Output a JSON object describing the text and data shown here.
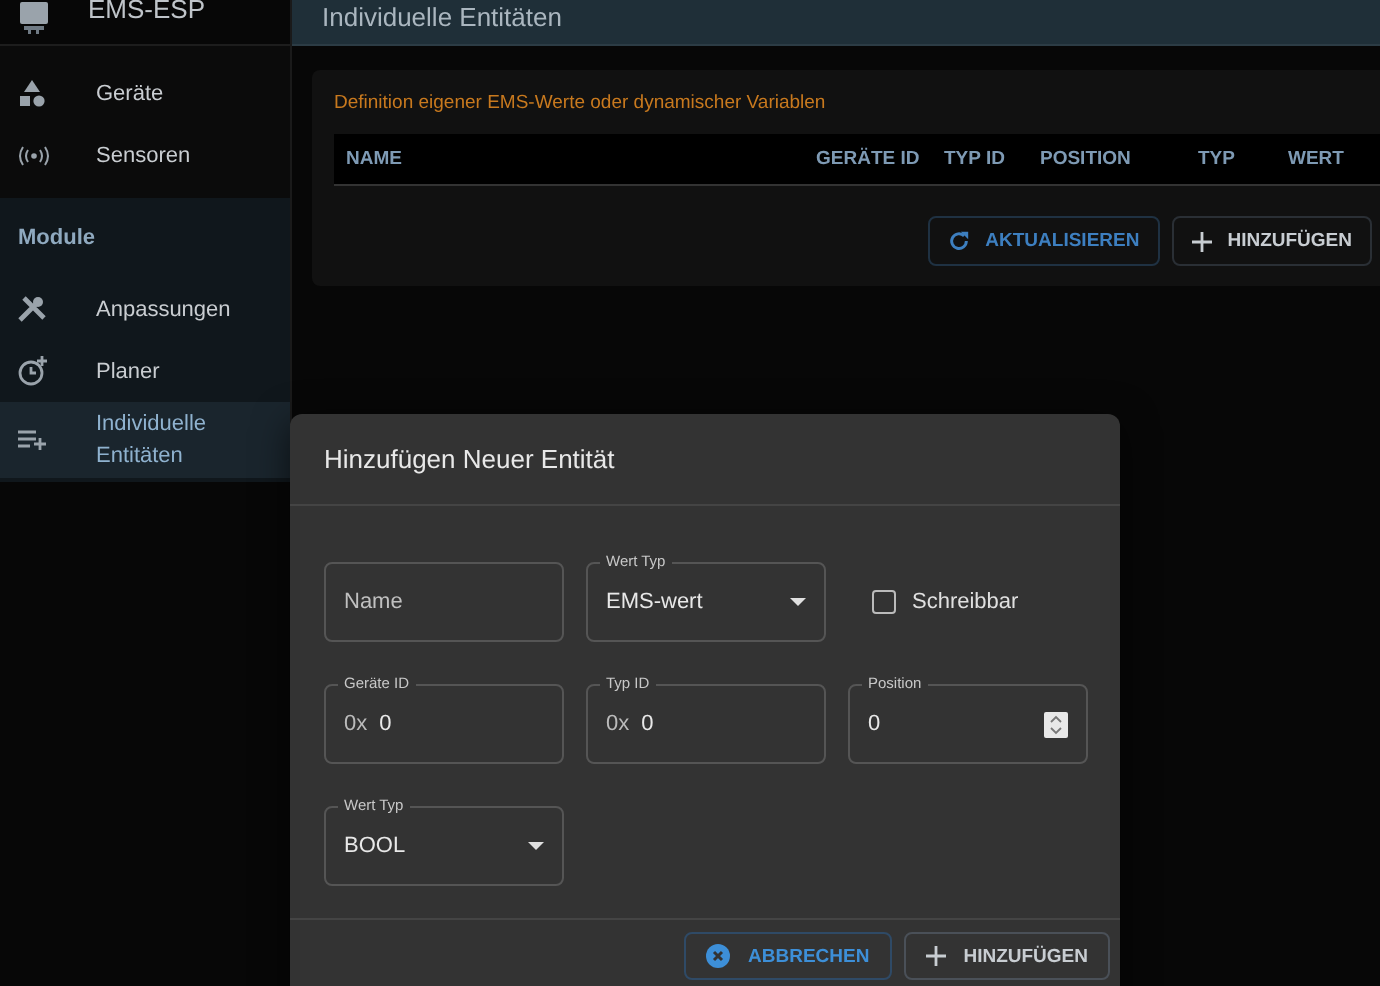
{
  "sidebar": {
    "brand": "EMS-ESP",
    "items": [
      {
        "label": "Geräte",
        "kind": "devices",
        "selected": false
      },
      {
        "label": "Sensoren",
        "kind": "sensors",
        "selected": false
      }
    ],
    "section": "Module",
    "module_items": [
      {
        "label": "Anpassungen",
        "kind": "tools",
        "selected": false
      },
      {
        "label": "Planer",
        "kind": "scheduler",
        "selected": false
      },
      {
        "label": "Individuelle Entitäten",
        "kind": "entities",
        "selected": true
      }
    ]
  },
  "header": {
    "title": "Individuelle Entitäten"
  },
  "card": {
    "description": "Definition eigener EMS-Werte oder dynamischer Variablen",
    "table": {
      "columns": [
        "NAME",
        "GERÄTE ID",
        "TYP ID",
        "POSITION",
        "TYP",
        "WERT"
      ]
    },
    "buttons": [
      {
        "label": "AKTUALISIEREN",
        "kind": "refresh"
      },
      {
        "label": "HINZUFÜGEN",
        "kind": "add"
      }
    ]
  },
  "dialog": {
    "title": "Hinzufügen Neuer Entität",
    "fields": [
      {
        "kind": "text",
        "placeholder": "Name"
      },
      {
        "kind": "select",
        "label": "Wert Typ",
        "value": "EMS-wert"
      },
      {
        "kind": "checkbox",
        "label": "Schreibbar",
        "checked": false
      },
      {
        "kind": "hex",
        "label": "Geräte ID",
        "prefix": "0x",
        "value": "0"
      },
      {
        "kind": "hex",
        "label": "Typ ID",
        "prefix": "0x",
        "value": "0"
      },
      {
        "kind": "number",
        "label": "Position",
        "value": "0"
      },
      {
        "kind": "select",
        "label": "Wert Typ",
        "value": "BOOL"
      }
    ],
    "buttons": [
      {
        "label": "ABBRECHEN",
        "kind": "cancel"
      },
      {
        "label": "HINZUFÜGEN",
        "kind": "add"
      }
    ]
  }
}
